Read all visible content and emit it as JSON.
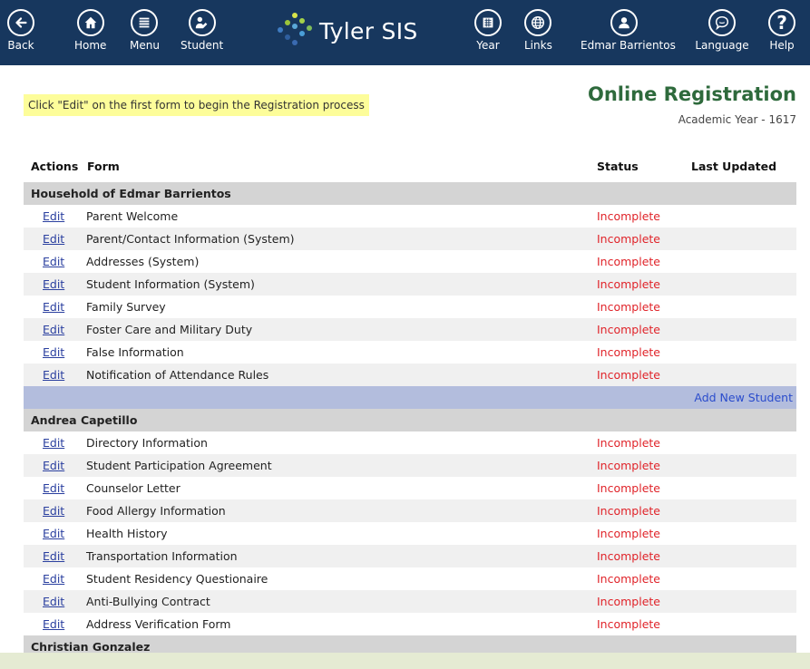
{
  "nav": {
    "back": "Back",
    "home": "Home",
    "menu": "Menu",
    "student": "Student",
    "year": "Year",
    "links": "Links",
    "user": "Edmar Barrientos",
    "language": "Language",
    "help": "Help"
  },
  "logo": {
    "title": "Tyler SIS"
  },
  "hint": "Click \"Edit\" on the first form to begin the Registration process",
  "page": {
    "title": "Online Registration",
    "academic_year": "Academic Year - 1617"
  },
  "columns": {
    "actions": "Actions",
    "form": "Form",
    "status": "Status",
    "updated": "Last Updated"
  },
  "edit_label": "Edit",
  "groups": [
    {
      "name": "Household of Edmar Barrientos",
      "forms": [
        {
          "form": "Parent Welcome",
          "status": "Incomplete"
        },
        {
          "form": "Parent/Contact Information (System)",
          "status": "Incomplete"
        },
        {
          "form": "Addresses (System)",
          "status": "Incomplete"
        },
        {
          "form": "Student Information (System)",
          "status": "Incomplete"
        },
        {
          "form": "Family Survey",
          "status": "Incomplete"
        },
        {
          "form": "Foster Care and Military Duty",
          "status": "Incomplete"
        },
        {
          "form": "False Information",
          "status": "Incomplete"
        },
        {
          "form": "Notification of Attendance Rules",
          "status": "Incomplete"
        }
      ]
    },
    {
      "name": "Andrea Capetillo",
      "forms": [
        {
          "form": "Directory Information",
          "status": "Incomplete"
        },
        {
          "form": "Student Participation Agreement",
          "status": "Incomplete"
        },
        {
          "form": "Counselor Letter",
          "status": "Incomplete"
        },
        {
          "form": "Food Allergy Information",
          "status": "Incomplete"
        },
        {
          "form": "Health History",
          "status": "Incomplete"
        },
        {
          "form": "Transportation Information",
          "status": "Incomplete"
        },
        {
          "form": "Student Residency Questionaire",
          "status": "Incomplete"
        },
        {
          "form": "Anti-Bullying Contract",
          "status": "Incomplete"
        },
        {
          "form": "Address Verification Form",
          "status": "Incomplete"
        }
      ]
    },
    {
      "name": "Christian Gonzalez",
      "forms": []
    }
  ],
  "add_student": "Add New Student",
  "colors": {
    "topbar": "#17375e",
    "status": "#e0242a",
    "link": "#2a3f9f",
    "title": "#2e6a3c"
  }
}
